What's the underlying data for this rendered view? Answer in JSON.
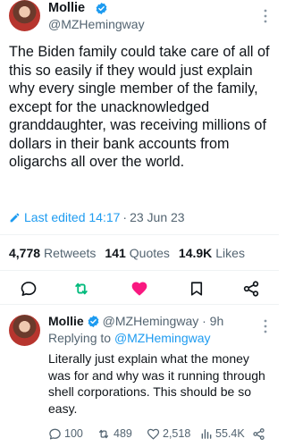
{
  "main_tweet": {
    "author_name": "Mollie",
    "author_handle": "@MZHemingway",
    "text": "The Biden family could take care of all of this so easily if they would just explain why every single member of the family, except for the unacknowledged granddaughter, was receiving millions of dollars in their bank accounts from oligarchs all over the world.",
    "edit_label": "Last edited 14:17",
    "edit_separator": "·",
    "edit_date": "23 Jun 23",
    "stats": {
      "retweets_count": "4,778",
      "retweets_label": "Retweets",
      "quotes_count": "141",
      "quotes_label": "Quotes",
      "likes_count": "14.9K",
      "likes_label": "Likes"
    }
  },
  "reply_tweet": {
    "author_name": "Mollie",
    "author_handle_time": "@MZHemingway · 9h",
    "replying_prefix": "Replying to ",
    "replying_handle": "@MZHemingway",
    "text": "Literally just explain what the money was for and why was it running through shell corporations. This should be so easy.",
    "actions": {
      "replies": "100",
      "retweets": "489",
      "likes": "2,518",
      "views": "55.4K"
    }
  },
  "colors": {
    "accent_blue": "#1d9bf0",
    "retweet_green": "#00ba7c",
    "like_pink": "#f91880",
    "secondary_text": "#536471",
    "primary_text": "#0f1419"
  },
  "icons": [
    "verified-badge-icon",
    "more-options-icon",
    "pencil-edit-icon",
    "reply-icon",
    "retweet-icon",
    "like-heart-icon",
    "bookmark-icon",
    "share-icon",
    "views-chart-icon"
  ]
}
